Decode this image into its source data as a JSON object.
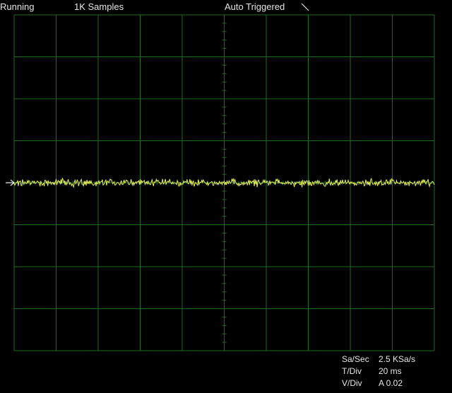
{
  "status": {
    "run_state": "Running",
    "samples": "1K Samples",
    "trigger_mode": "Auto Triggered",
    "trigger_slope_icon": "falling-edge-icon"
  },
  "readouts": {
    "sample_rate_label": "Sa/Sec",
    "sample_rate_value": "2.5 KSa/s",
    "time_div_label": "T/Div",
    "time_div_value": "20 ms",
    "volt_div_label": "V/Div",
    "volt_div_value": "A 0.02"
  },
  "colors": {
    "background": "#000000",
    "grid": "#1f6b1f",
    "trace": "#e8f25a",
    "text": "#e6e6e6"
  },
  "grid": {
    "horizontal_divisions": 10,
    "vertical_divisions": 8,
    "minor_ticks_per_division": 5
  },
  "trace": {
    "channel": "A",
    "ground_marker_icon": "channel-arrow-icon",
    "offset_divisions": 0,
    "noise_amplitude_divisions": 0.12
  }
}
